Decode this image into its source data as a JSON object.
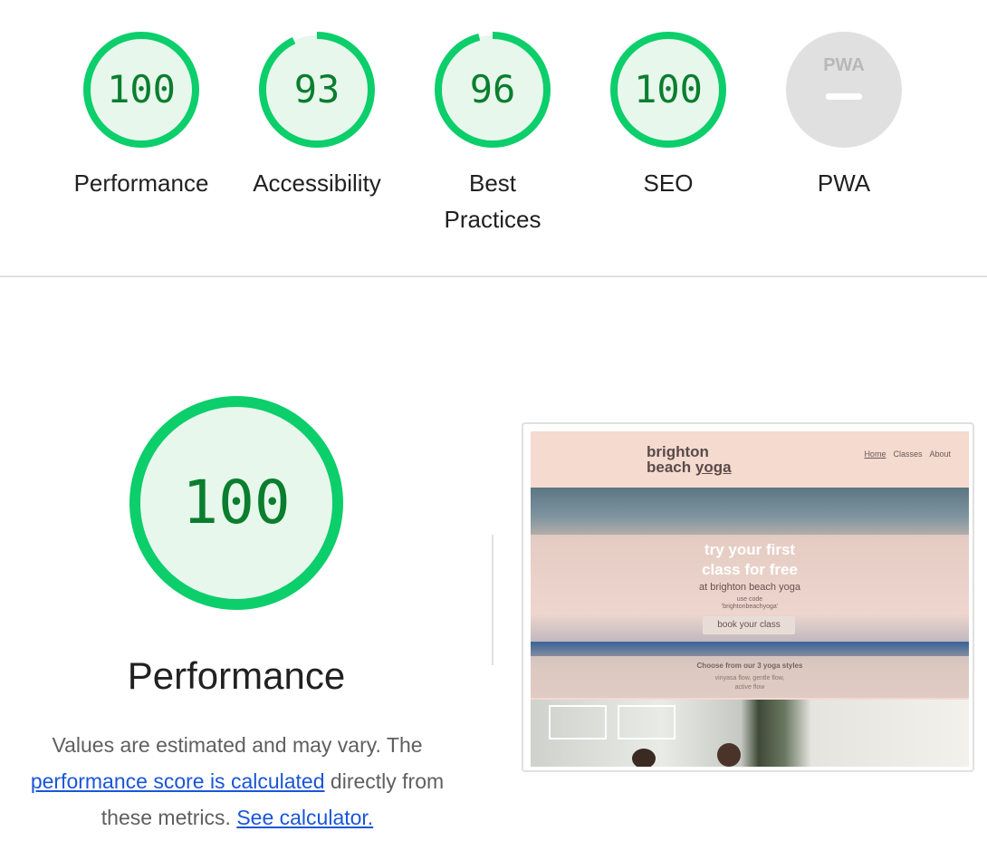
{
  "colors": {
    "pass": "#0cce6b",
    "pass_text": "#0a7e2e",
    "pass_bg": "#e8f7ec",
    "na": "#e0e0e0",
    "na_text": "#bdbdbd",
    "link": "#1a55d8"
  },
  "summary": [
    {
      "label": "Performance",
      "score": "100",
      "value": 100
    },
    {
      "label": "Accessibility",
      "score": "93",
      "value": 93
    },
    {
      "label": "Best Practices",
      "score": "96",
      "value": 96
    },
    {
      "label": "SEO",
      "score": "100",
      "value": 100
    },
    {
      "label": "PWA",
      "score": "",
      "icon": "pwa-badge-icon",
      "badge_text": "PWA"
    }
  ],
  "performance": {
    "score": "100",
    "value": 100,
    "title": "Performance",
    "desc_pre": "Values are estimated and may vary. The",
    "desc_link1": "performance score is calculated",
    "desc_mid": " directly from these metrics. ",
    "desc_link2": "See calculator."
  },
  "screenshot": {
    "brand_line1": "brighton",
    "brand_line2a": "beach ",
    "brand_line2b": "yoga",
    "nav": [
      "Home",
      "Classes",
      "About"
    ],
    "hero_heading_line1": "try your first",
    "hero_heading_line2": "class for free",
    "hero_sub": "at brighton beach yoga",
    "hero_code_line1": "use code",
    "hero_code_line2": "'brightonbeachyoga'",
    "hero_button": "book your class",
    "styles_heading": "Choose from our 3 yoga styles",
    "styles_text_line1": "vinyasa flow, gentle flow,",
    "styles_text_line2": "active flow"
  }
}
